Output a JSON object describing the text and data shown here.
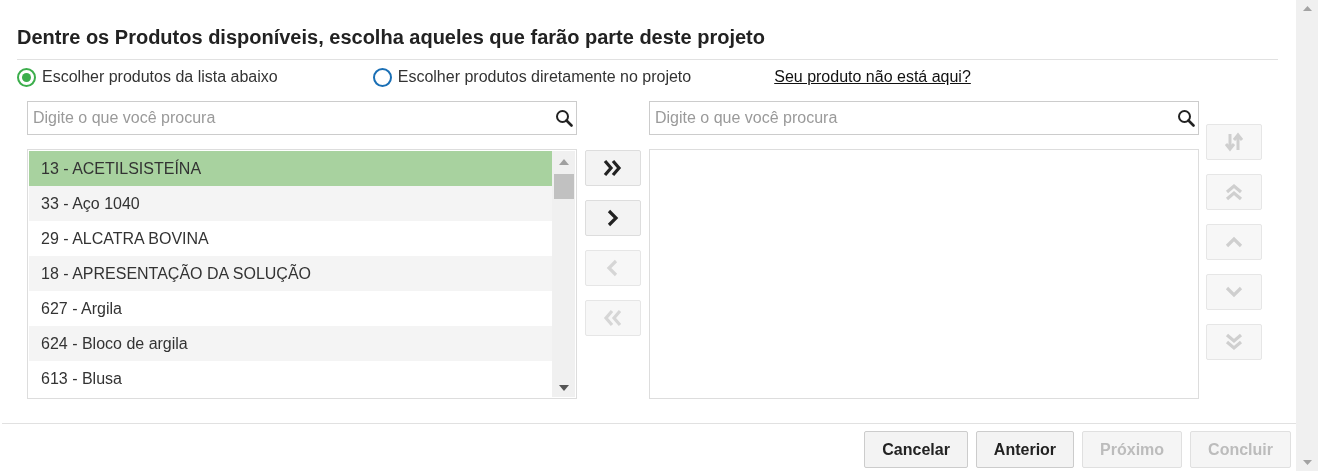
{
  "title": "Dentre os Produtos disponíveis, escolha aqueles que farão parte deste projeto",
  "source_options": [
    {
      "label": "Escolher produtos da lista abaixo",
      "selected": true
    },
    {
      "label": "Escolher produtos diretamente no projeto",
      "selected": false
    }
  ],
  "help_link": "Seu produto não está aqui?",
  "available": {
    "search": {
      "placeholder": "Digite o que você procura"
    },
    "items": [
      {
        "label": "13 - ACETILSISTEÍNA",
        "selected": true
      },
      {
        "label": "33 - Aço 1040",
        "selected": false
      },
      {
        "label": "29 - ALCATRA BOVINA",
        "selected": false
      },
      {
        "label": "18 - APRESENTAÇÃO DA SOLUÇÃO",
        "selected": false
      },
      {
        "label": "627 - Argila",
        "selected": false
      },
      {
        "label": "624 - Bloco de argila",
        "selected": false
      },
      {
        "label": "613 - Blusa",
        "selected": false
      }
    ]
  },
  "transfer_buttons": [
    {
      "kind": "all-right",
      "disabled": false
    },
    {
      "kind": "right",
      "disabled": false
    },
    {
      "kind": "left",
      "disabled": true
    },
    {
      "kind": "all-left",
      "disabled": true
    }
  ],
  "chosen": {
    "search": {
      "placeholder": "Digite o que você procura"
    }
  },
  "order_buttons": [
    {
      "kind": "sort",
      "disabled": true
    },
    {
      "kind": "top",
      "disabled": true
    },
    {
      "kind": "up",
      "disabled": true
    },
    {
      "kind": "down",
      "disabled": true
    },
    {
      "kind": "bottom",
      "disabled": true
    }
  ],
  "footer_buttons": [
    {
      "label": "Cancelar",
      "disabled": false
    },
    {
      "label": "Anterior",
      "disabled": false
    },
    {
      "label": "Próximo",
      "disabled": true
    },
    {
      "label": "Concluir",
      "disabled": true
    }
  ]
}
